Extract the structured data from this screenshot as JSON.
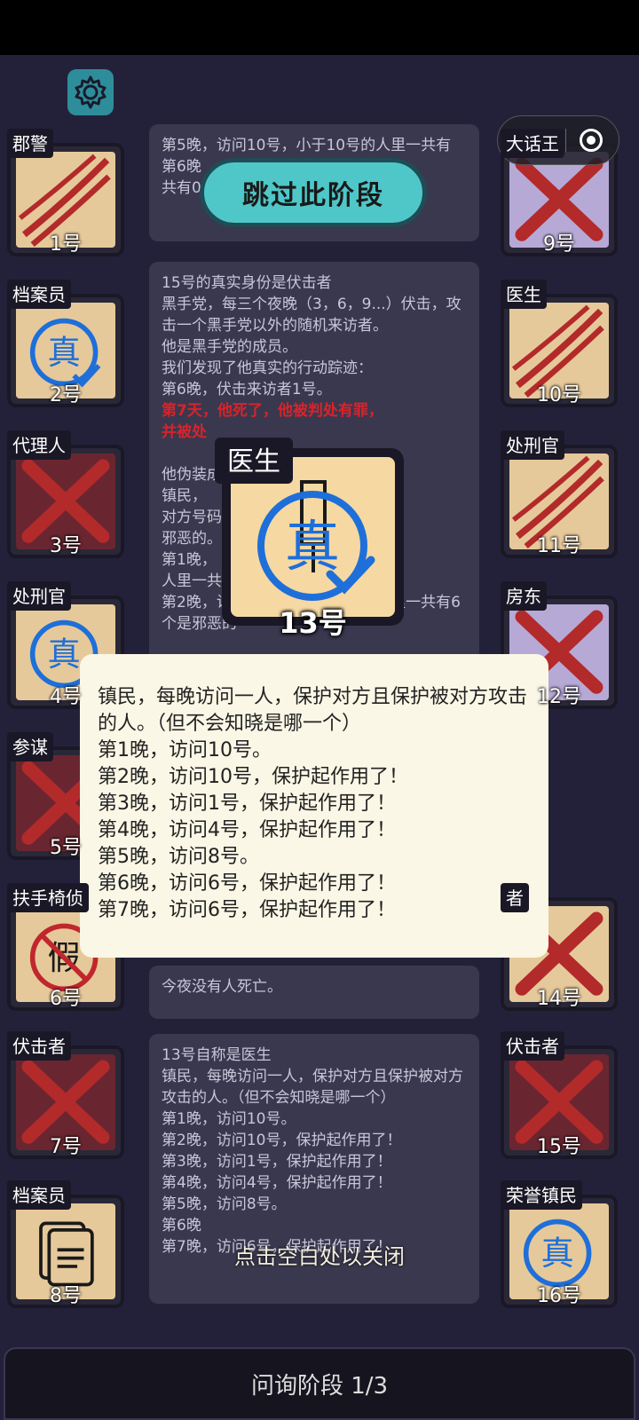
{
  "phase_label": "问询阶段 1/3",
  "skip_button": "跳过此阶段",
  "close_hint": "点击空白处以关闭",
  "true_stamp": "真",
  "fake_stamp": "假",
  "left_players": [
    {
      "role": "郡警",
      "num": "1号"
    },
    {
      "role": "档案员",
      "num": "2号"
    },
    {
      "role": "代理人",
      "num": "3号"
    },
    {
      "role": "处刑官",
      "num": "4号"
    },
    {
      "role": "参谋",
      "num": "5号"
    },
    {
      "role": "扶手椅侦",
      "num": "6号"
    },
    {
      "role": "伏击者",
      "num": "7号"
    },
    {
      "role": "档案员",
      "num": "8号"
    }
  ],
  "right_players": [
    {
      "role": "大话王",
      "num": "9号"
    },
    {
      "role": "医生",
      "num": "10号"
    },
    {
      "role": "处刑官",
      "num": "11号"
    },
    {
      "role": "房东",
      "num": "12号"
    },
    {
      "role": "者",
      "num": "14号"
    },
    {
      "role": "伏击者",
      "num": "15号"
    },
    {
      "role": "荣誉镇民",
      "num": "16号"
    }
  ],
  "log_top": {
    "lines": [
      "第5晚，访问10号，小于10号的人里一共有",
      "第6晚",
      "共有0"
    ]
  },
  "log_middle": {
    "lines": [
      "15号的真实身份是伏击者",
      "黑手党，每三个夜晚（3，6，9...）伏击，攻击一个黑手党以外的随机来访者。",
      "他是黑手党的成员。",
      "我们发现了他真实的行动踪迹：",
      "第6晚，伏击来访者1号。"
    ],
    "red_lines": [
      "第7天，他死了，他被判处有罪，",
      "并被处"
    ],
    "more_lines": [
      "他伪装成",
      "镇民，",
      "对方号码更小",
      "邪恶的。（",
      "第1晚，",
      "人里一共有1个",
      "第2晚，访问13号，小于13号的人里一共有6个是邪恶的"
    ]
  },
  "log_death": "今夜没有人死亡。",
  "log_bottom": {
    "lines": [
      "13号自称是医生",
      "镇民，每晚访问一人，保护对方且保护被对方攻击的人。（但不会知晓是哪一个）",
      "第1晚，访问10号。",
      "第2晚，访问10号，保护起作用了！",
      "第3晚，访问1号，保护起作用了！",
      "第4晚，访问4号，保护起作用了！",
      "第5晚，访问8号。",
      "第6晚",
      "第7晚，访问6号，保护起作用了！"
    ]
  },
  "popup_card": {
    "role": "医生",
    "num": "13号"
  },
  "popup": {
    "lines": [
      "镇民，每晚访问一人，保护对方且保护被对方攻击的人。（但不会知晓是哪一个）",
      "第1晚，访问10号。",
      "第2晚，访问10号，保护起作用了！",
      "第3晚，访问1号，保护起作用了！",
      "第4晚，访问4号，保护起作用了！",
      "第5晚，访问8号。",
      "第6晚，访问6号，保护起作用了！",
      "第7晚，访问6号，保护起作用了！"
    ]
  },
  "colors": {
    "accent": "#4fc7c9",
    "stamp": "#1e6fd9",
    "cross": "#b32a2a",
    "warning": "#d8232a"
  }
}
